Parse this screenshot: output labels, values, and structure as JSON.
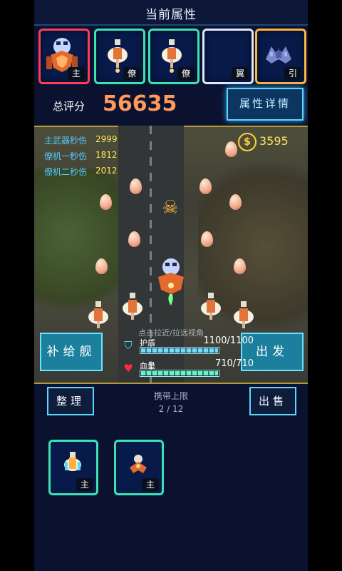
{
  "header": {
    "title": "当前属性"
  },
  "slots": [
    {
      "tag": "主",
      "icon": "main-ship-icon"
    },
    {
      "tag": "僚",
      "icon": "wingman-icon"
    },
    {
      "tag": "僚",
      "icon": "wingman-icon"
    },
    {
      "tag": "翼",
      "icon": "empty-slot-icon"
    },
    {
      "tag": "引",
      "icon": "engine-icon"
    }
  ],
  "score": {
    "label": "总评分",
    "value": "56635",
    "detail_button": "属性详情"
  },
  "stats": [
    {
      "label": "主武器秒伤",
      "value": "2999"
    },
    {
      "label": "僚机一秒伤",
      "value": "1812"
    },
    {
      "label": "僚机二秒伤",
      "value": "2012"
    }
  ],
  "coins": "3595",
  "hint": "点击拉近/拉远视角",
  "supply_button": "补给舰",
  "start_button": "出发",
  "shield": {
    "label": "护盾",
    "value": "1100/1100",
    "fraction": 1.0
  },
  "hp": {
    "label": "血量",
    "value": "710/710",
    "fraction": 1.0
  },
  "inventory": {
    "sort_button": "整理",
    "sell_button": "出售",
    "capacity_label": "携带上限",
    "capacity_value": "2 / 12",
    "items": [
      {
        "tag": "主"
      },
      {
        "tag": "主"
      }
    ]
  },
  "colors": {
    "accent": "#58d7ff",
    "score": "#ff9a5b",
    "stat_value": "#ffe25a",
    "rare": "#3fe1b3",
    "epic": "#ff3b5a",
    "legend": "#ffb23f"
  }
}
